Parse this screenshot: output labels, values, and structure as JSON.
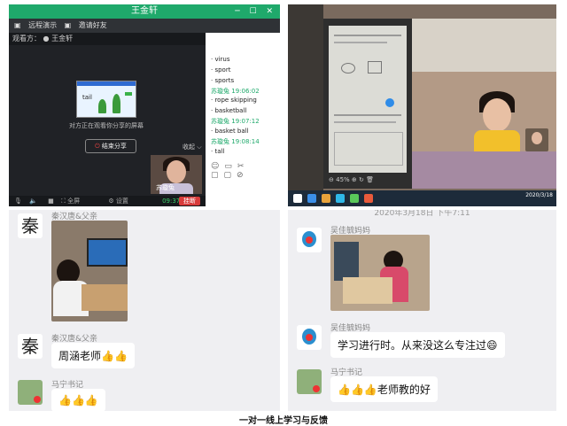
{
  "video_call": {
    "title": "王金轩",
    "toolbar": {
      "remote_demo": "远程演示",
      "invite_friend": "邀请好友"
    },
    "viewer_label": "观看方：",
    "viewer_name": "王金轩",
    "shared_screen_word": "tail",
    "share_notice": "对方正在观看你分享的屏幕",
    "stop_share_label": "结束分享",
    "collapse_label": "收起",
    "camera_name": "苏璇兔",
    "bottom": {
      "fullscreen": "全屏",
      "settings": "设置",
      "time": "09:37",
      "hangup": "挂断"
    },
    "chat": [
      {
        "text": "virus"
      },
      {
        "text": "sport"
      },
      {
        "text": "sports"
      },
      {
        "sender": "苏璇兔",
        "time": "19:06:02"
      },
      {
        "text": "rope skipping"
      },
      {
        "text": "basketball"
      },
      {
        "sender": "苏璇兔",
        "time": "19:07:12"
      },
      {
        "text": "basket ball"
      },
      {
        "sender": "苏璇兔",
        "time": "19:08:14"
      },
      {
        "text": "tall"
      }
    ]
  },
  "worksheet_call": {
    "zoom_level": "45%",
    "clock": "2020/3/18"
  },
  "chat_left": {
    "messages": [
      {
        "user": "秦汉唐&父亲",
        "avatar_char": "秦",
        "type": "photo"
      },
      {
        "user": "秦汉唐&父亲",
        "avatar_char": "秦",
        "text": "周涵老师👍👍"
      },
      {
        "user": "马宁书记",
        "text": "👍👍👍"
      }
    ]
  },
  "chat_right": {
    "timestamp": "2020年3月18日 下午7:11",
    "messages": [
      {
        "user": "吴佳毓妈妈",
        "type": "photo"
      },
      {
        "user": "吴佳毓妈妈",
        "text": "学习进行时。从来没这么专注过😄"
      },
      {
        "user": "马宁书记",
        "text": "👍👍👍老师教的好"
      }
    ]
  },
  "caption": "一对一线上学习与反馈",
  "colors": {
    "accent": "#1fa96b",
    "hangup": "#d83b3b",
    "chat_bg": "#efeff2"
  }
}
